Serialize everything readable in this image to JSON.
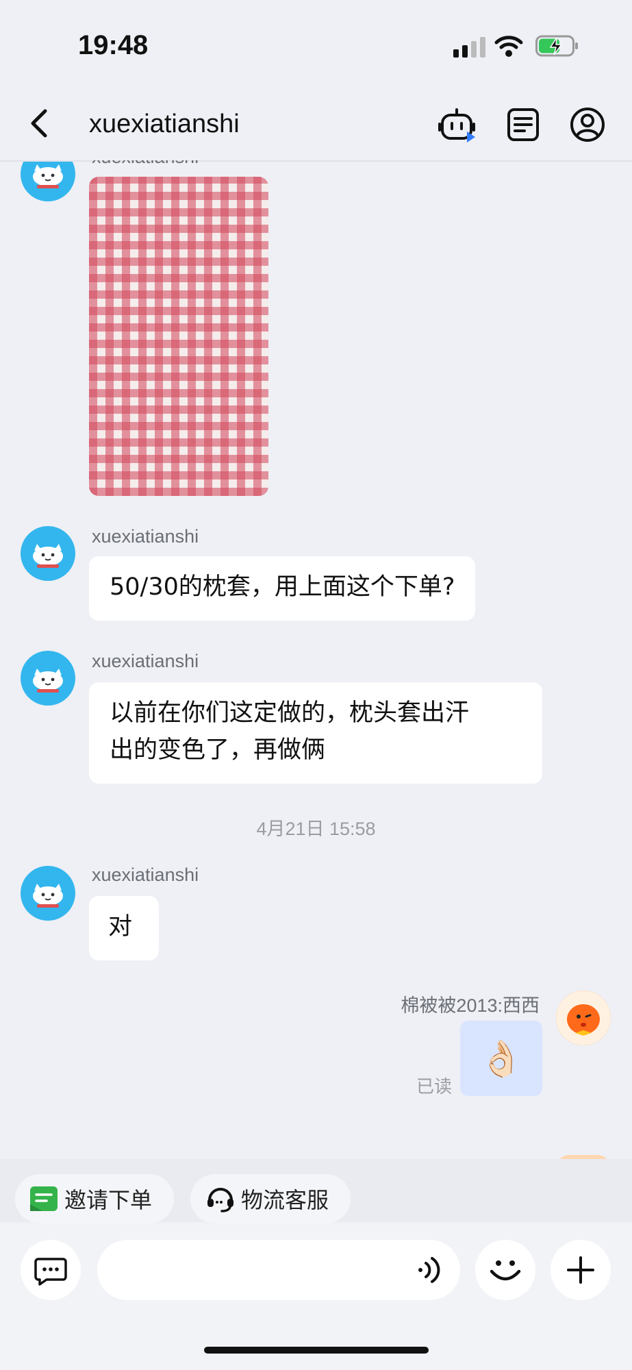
{
  "status_bar": {
    "time": "19:48"
  },
  "header": {
    "title": "xuexiatianshi"
  },
  "messages": {
    "m0_sender": "xuexiatianshi",
    "m1_sender": "xuexiatianshi",
    "m1_text": "50/30的枕套，用上面这个下单?",
    "m2_sender": "xuexiatianshi",
    "m2_line1": "以前在你们这定做的，枕头套出汗",
    "m2_line2": "出的变色了，再做俩",
    "timestamp": "4月21日 15:58",
    "m3_sender": "xuexiatianshi",
    "m3_text": "对",
    "m4_sender": "棉被被2013:西西",
    "m4_read": "已读",
    "m4_emoji": "👌🏻"
  },
  "quick_actions": [
    {
      "label": "邀请下单"
    },
    {
      "label": "物流客服"
    }
  ],
  "colors": {
    "accent": "#33b6ee",
    "my_bubble": "#d9e5ff"
  }
}
